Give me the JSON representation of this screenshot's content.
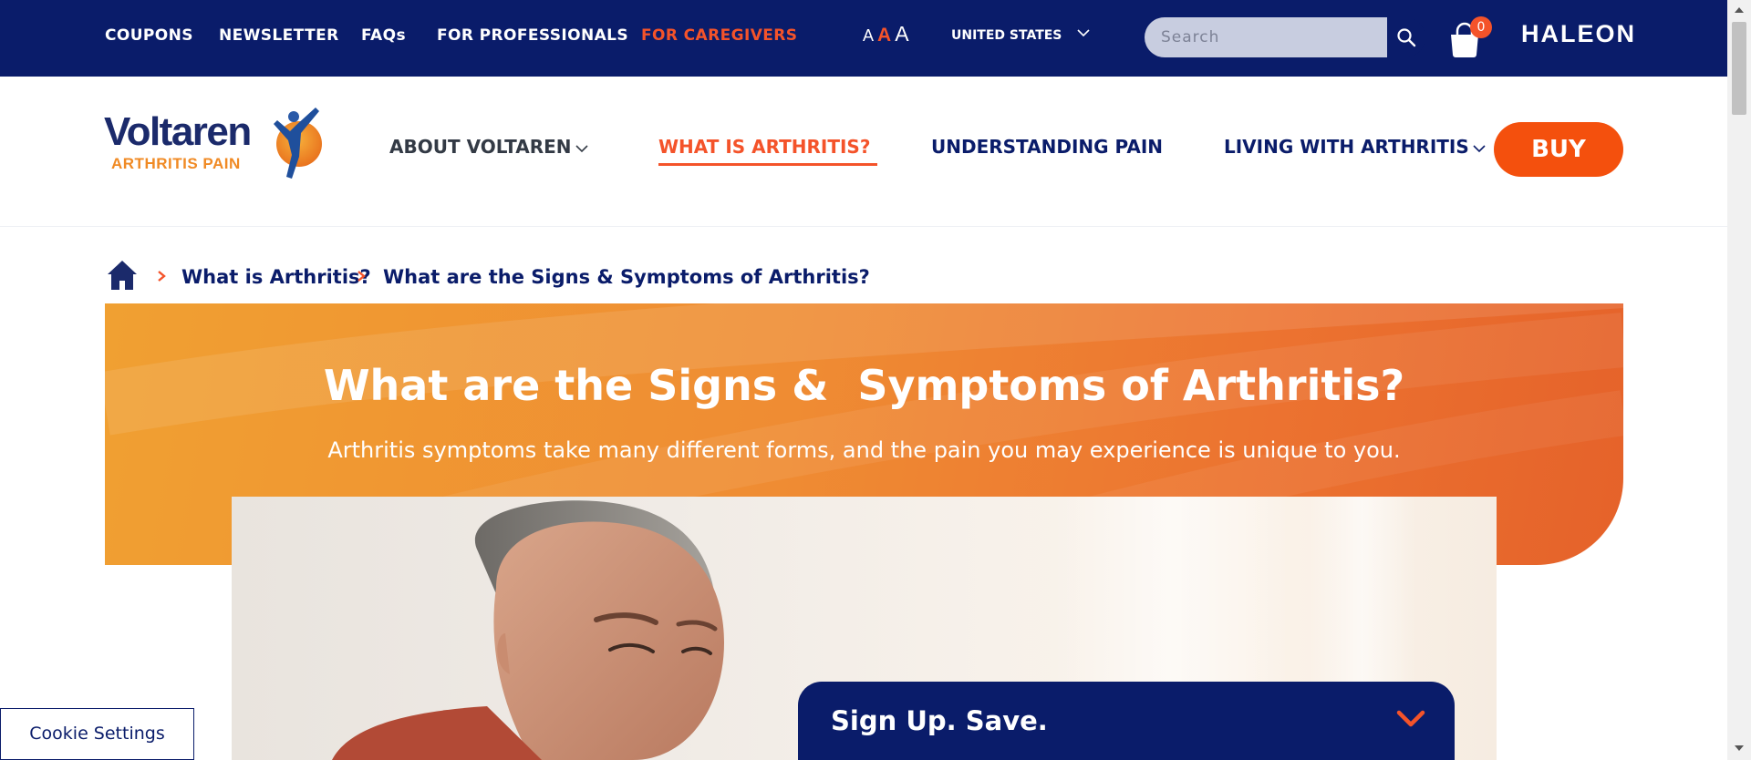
{
  "topbar": {
    "links": [
      "COUPONS",
      "NEWSLETTER",
      "FAQs",
      "FOR PROFESSIONALS",
      "FOR CAREGIVERS"
    ],
    "font_sizes": [
      "A",
      "A",
      "A"
    ],
    "country": "UNITED STATES",
    "search_placeholder": "Search",
    "cart_count": "0",
    "brand": "HALEON"
  },
  "logo": {
    "name": "Voltaren",
    "subtitle": "ARTHRITIS PAIN"
  },
  "nav": {
    "items": [
      "ABOUT VOLTAREN",
      "WHAT IS ARTHRITIS?",
      "UNDERSTANDING PAIN",
      "LIVING WITH ARTHRITIS"
    ],
    "active": "WHAT IS ARTHRITIS?",
    "buy_label": "BUY"
  },
  "breadcrumb": {
    "items": [
      "What is Arthritis?",
      "What are the Signs & Symptoms of Arthritis?"
    ]
  },
  "hero": {
    "title": "What are the Signs &  Symptoms of Arthritis?",
    "subtitle": "Arthritis symptoms take many different forms, and the pain you may experience is unique to you."
  },
  "signup": {
    "title": "Sign Up. Save."
  },
  "cookie": {
    "label": "Cookie Settings"
  },
  "colors": {
    "navy": "#0a1c6a",
    "accent_orange": "#f4532a",
    "buy_orange": "#f4500d",
    "hero_gradient_start": "#f0a032",
    "hero_gradient_end": "#e5622a"
  },
  "icons": [
    "chevron-down-icon",
    "search-icon",
    "shopping-bag-icon",
    "home-icon",
    "chevron-right-icon"
  ]
}
